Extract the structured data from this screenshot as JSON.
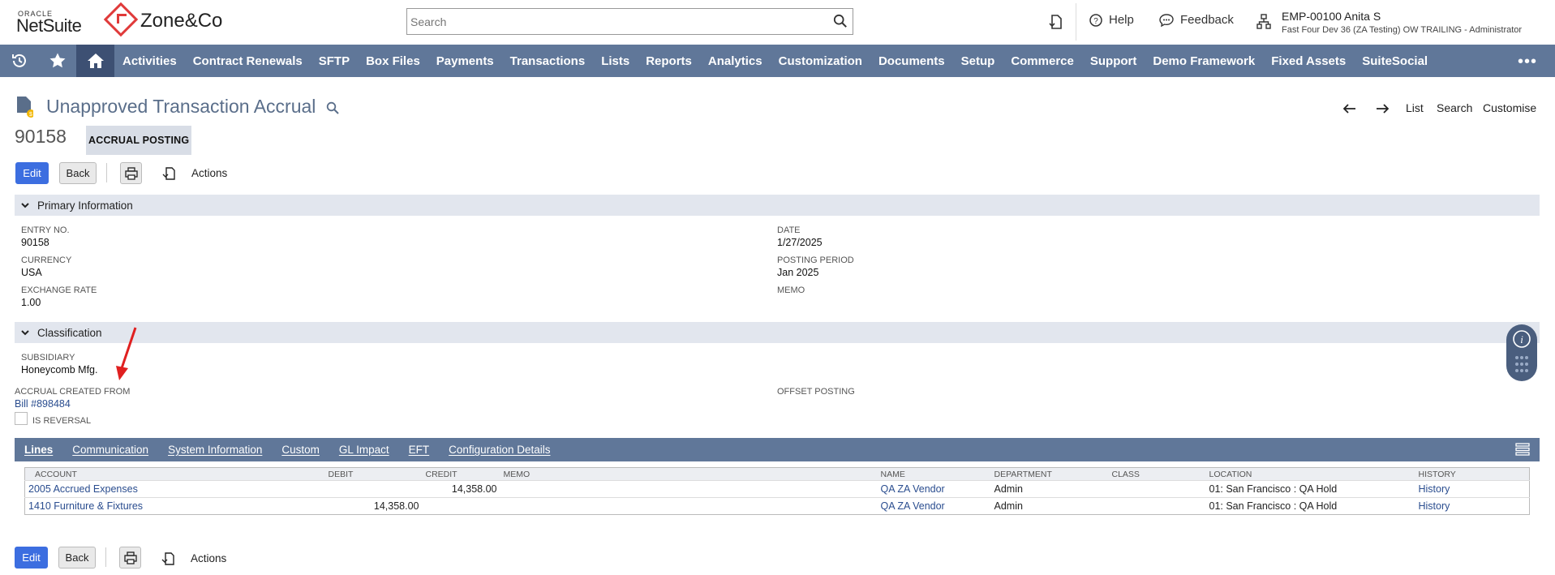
{
  "header": {
    "oracle_label": "ORACLE",
    "netsuite_label": "NetSuite",
    "zone_label": "Zone&Co",
    "search_placeholder": "Search",
    "help_label": "Help",
    "feedback_label": "Feedback",
    "user_name": "EMP-00100 Anita S",
    "user_role": "Fast Four Dev 36 (ZA Testing) OW TRAILING - Administrator"
  },
  "nav": {
    "items": [
      "Activities",
      "Contract Renewals",
      "SFTP",
      "Box Files",
      "Payments",
      "Transactions",
      "Lists",
      "Reports",
      "Analytics",
      "Customization",
      "Documents",
      "Setup",
      "Commerce",
      "Support",
      "Demo Framework",
      "Fixed Assets",
      "SuiteSocial"
    ],
    "more": "•••"
  },
  "record": {
    "title": "Unapproved Transaction Accrual",
    "number": "90158",
    "status": "ACCRUAL POSTING",
    "links": {
      "list": "List",
      "search": "Search",
      "customise": "Customise"
    }
  },
  "buttons": {
    "edit": "Edit",
    "back": "Back",
    "actions": "Actions"
  },
  "primary": {
    "heading": "Primary Information",
    "entry_no_label": "ENTRY NO.",
    "entry_no": "90158",
    "currency_label": "CURRENCY",
    "currency": "USA",
    "exchange_rate_label": "EXCHANGE RATE",
    "exchange_rate": "1.00",
    "date_label": "DATE",
    "date": "1/27/2025",
    "posting_period_label": "POSTING PERIOD",
    "posting_period": "Jan 2025",
    "memo_label": "MEMO"
  },
  "classification": {
    "heading": "Classification",
    "subsidiary_label": "SUBSIDIARY",
    "subsidiary": "Honeycomb Mfg.",
    "accrual_created_from_label": "ACCRUAL CREATED FROM",
    "accrual_created_from": "Bill #898484",
    "offset_posting_label": "OFFSET POSTING",
    "is_reversal_label": "IS REVERSAL"
  },
  "tabs": [
    "Lines",
    "Communication",
    "System Information",
    "Custom",
    "GL Impact",
    "EFT",
    "Configuration Details"
  ],
  "lines": {
    "headers": {
      "account": "ACCOUNT",
      "debit": "DEBIT",
      "credit": "CREDIT",
      "memo": "MEMO",
      "name": "NAME",
      "department": "DEPARTMENT",
      "class": "CLASS",
      "location": "LOCATION",
      "history": "HISTORY"
    },
    "rows": [
      {
        "account": "2005 Accrued Expenses",
        "debit": "",
        "credit": "14,358.00",
        "memo": "",
        "name": "QA ZA Vendor",
        "department": "Admin",
        "class": "",
        "location": "01: San Francisco : QA Hold",
        "history": "History"
      },
      {
        "account": "1410 Furniture & Fixtures",
        "debit": "14,358.00",
        "credit": "",
        "memo": "",
        "name": "QA ZA Vendor",
        "department": "Admin",
        "class": "",
        "location": "01: San Francisco : QA Hold",
        "history": "History"
      }
    ]
  },
  "colors": {
    "nav": "#607799",
    "primary_button": "#3c6ee0",
    "annotation_arrow": "#e02020"
  }
}
